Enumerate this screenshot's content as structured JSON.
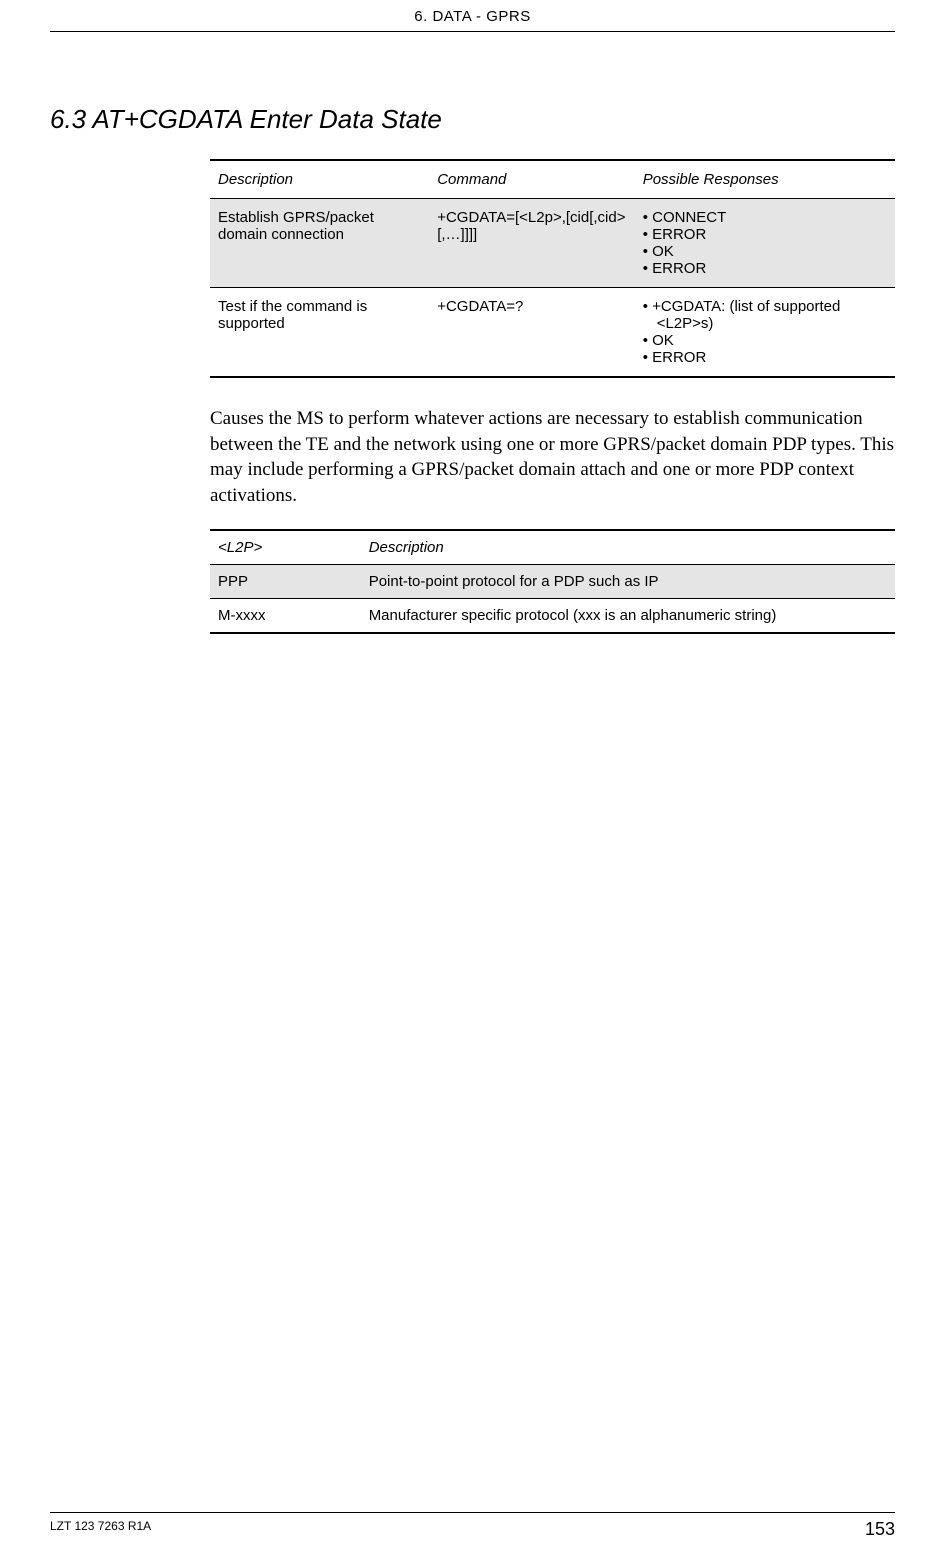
{
  "header": "6. DATA - GPRS",
  "section_title": "6.3 AT+CGDATA Enter Data State",
  "cmd_table": {
    "headers": [
      "Description",
      "Command",
      "Possible Responses"
    ],
    "rows": [
      {
        "desc": "Establish GPRS/packet domain connection",
        "cmd": "+CGDATA=[<L2p>,[cid[,cid>[,…]]]]",
        "responses": [
          "CONNECT",
          "ERROR",
          "OK",
          "ERROR"
        ]
      },
      {
        "desc": "Test if the command is supported",
        "cmd": "+CGDATA=?",
        "responses": [
          "+CGDATA: (list of supported <L2P>s)",
          "OK",
          "ERROR"
        ]
      }
    ]
  },
  "body_text": "Causes the MS to perform whatever actions are necessary to establish communication between the TE and the network using one or more GPRS/packet domain PDP types. This may include performing a GPRS/packet domain attach and one or more PDP context activations.",
  "param_table": {
    "headers": [
      "<L2P>",
      "Description"
    ],
    "rows": [
      {
        "l2p": "PPP",
        "desc": "Point-to-point protocol for a PDP such as IP"
      },
      {
        "l2p": "M-xxxx",
        "desc": "Manufacturer specific protocol (xxx is an alphanumeric string)"
      }
    ]
  },
  "footer": {
    "doc_id": "LZT 123 7263 R1A",
    "page_num": "153"
  }
}
